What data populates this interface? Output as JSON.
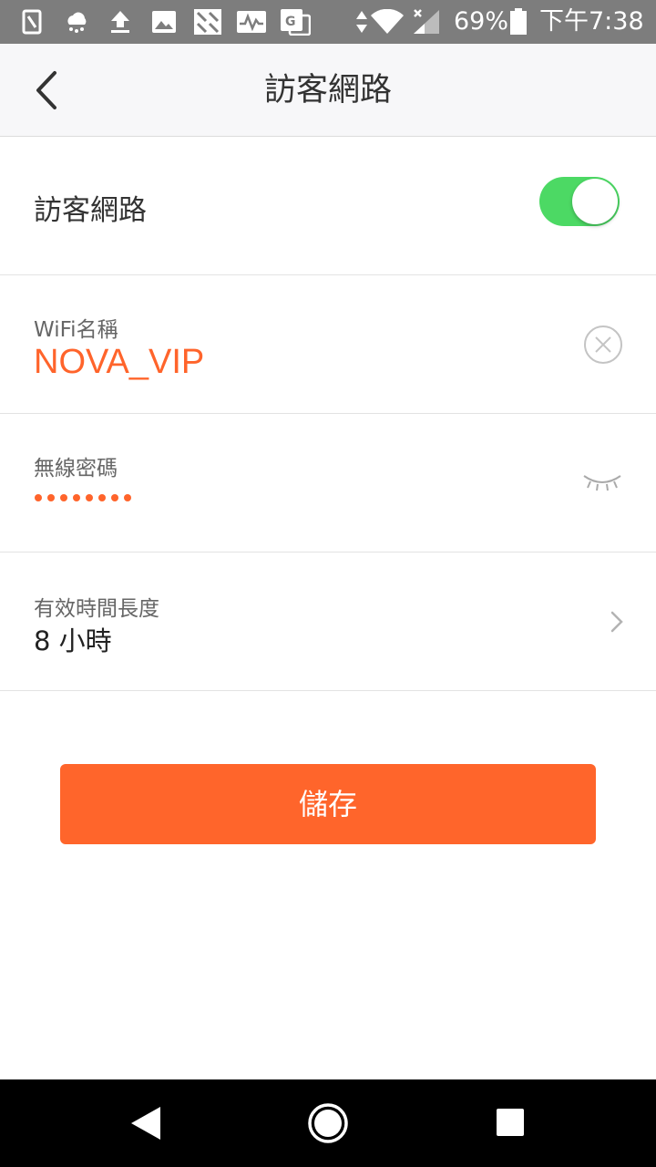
{
  "status_bar": {
    "battery": "69%",
    "time": "下午7:38",
    "icons": [
      "sim-icon",
      "weather-icon",
      "upload-icon",
      "image-icon",
      "pattern-icon",
      "activity-icon",
      "translate-icon",
      "data-arrows-icon",
      "wifi-icon",
      "signal-icon",
      "battery-icon"
    ]
  },
  "header": {
    "title": "訪客網路",
    "back_icon": "chevron-left-icon"
  },
  "guest_network": {
    "label": "訪客網路",
    "enabled": true,
    "toggle_color": "#4cd964"
  },
  "wifi_name": {
    "caption": "WiFi名稱",
    "value": "NOVA_VIP",
    "clear_icon": "clear-circle-icon"
  },
  "wireless_password": {
    "caption": "無線密碼",
    "dots": 8,
    "toggle_icon": "eye-closed-icon"
  },
  "valid_duration": {
    "caption": "有效時間長度",
    "value": "8 小時",
    "chevron_icon": "chevron-right-icon"
  },
  "save_button": {
    "label": "儲存",
    "color": "#ff652b"
  },
  "nav_bar": {
    "icons": [
      "back-triangle-icon",
      "home-circle-icon",
      "recents-square-icon"
    ]
  }
}
